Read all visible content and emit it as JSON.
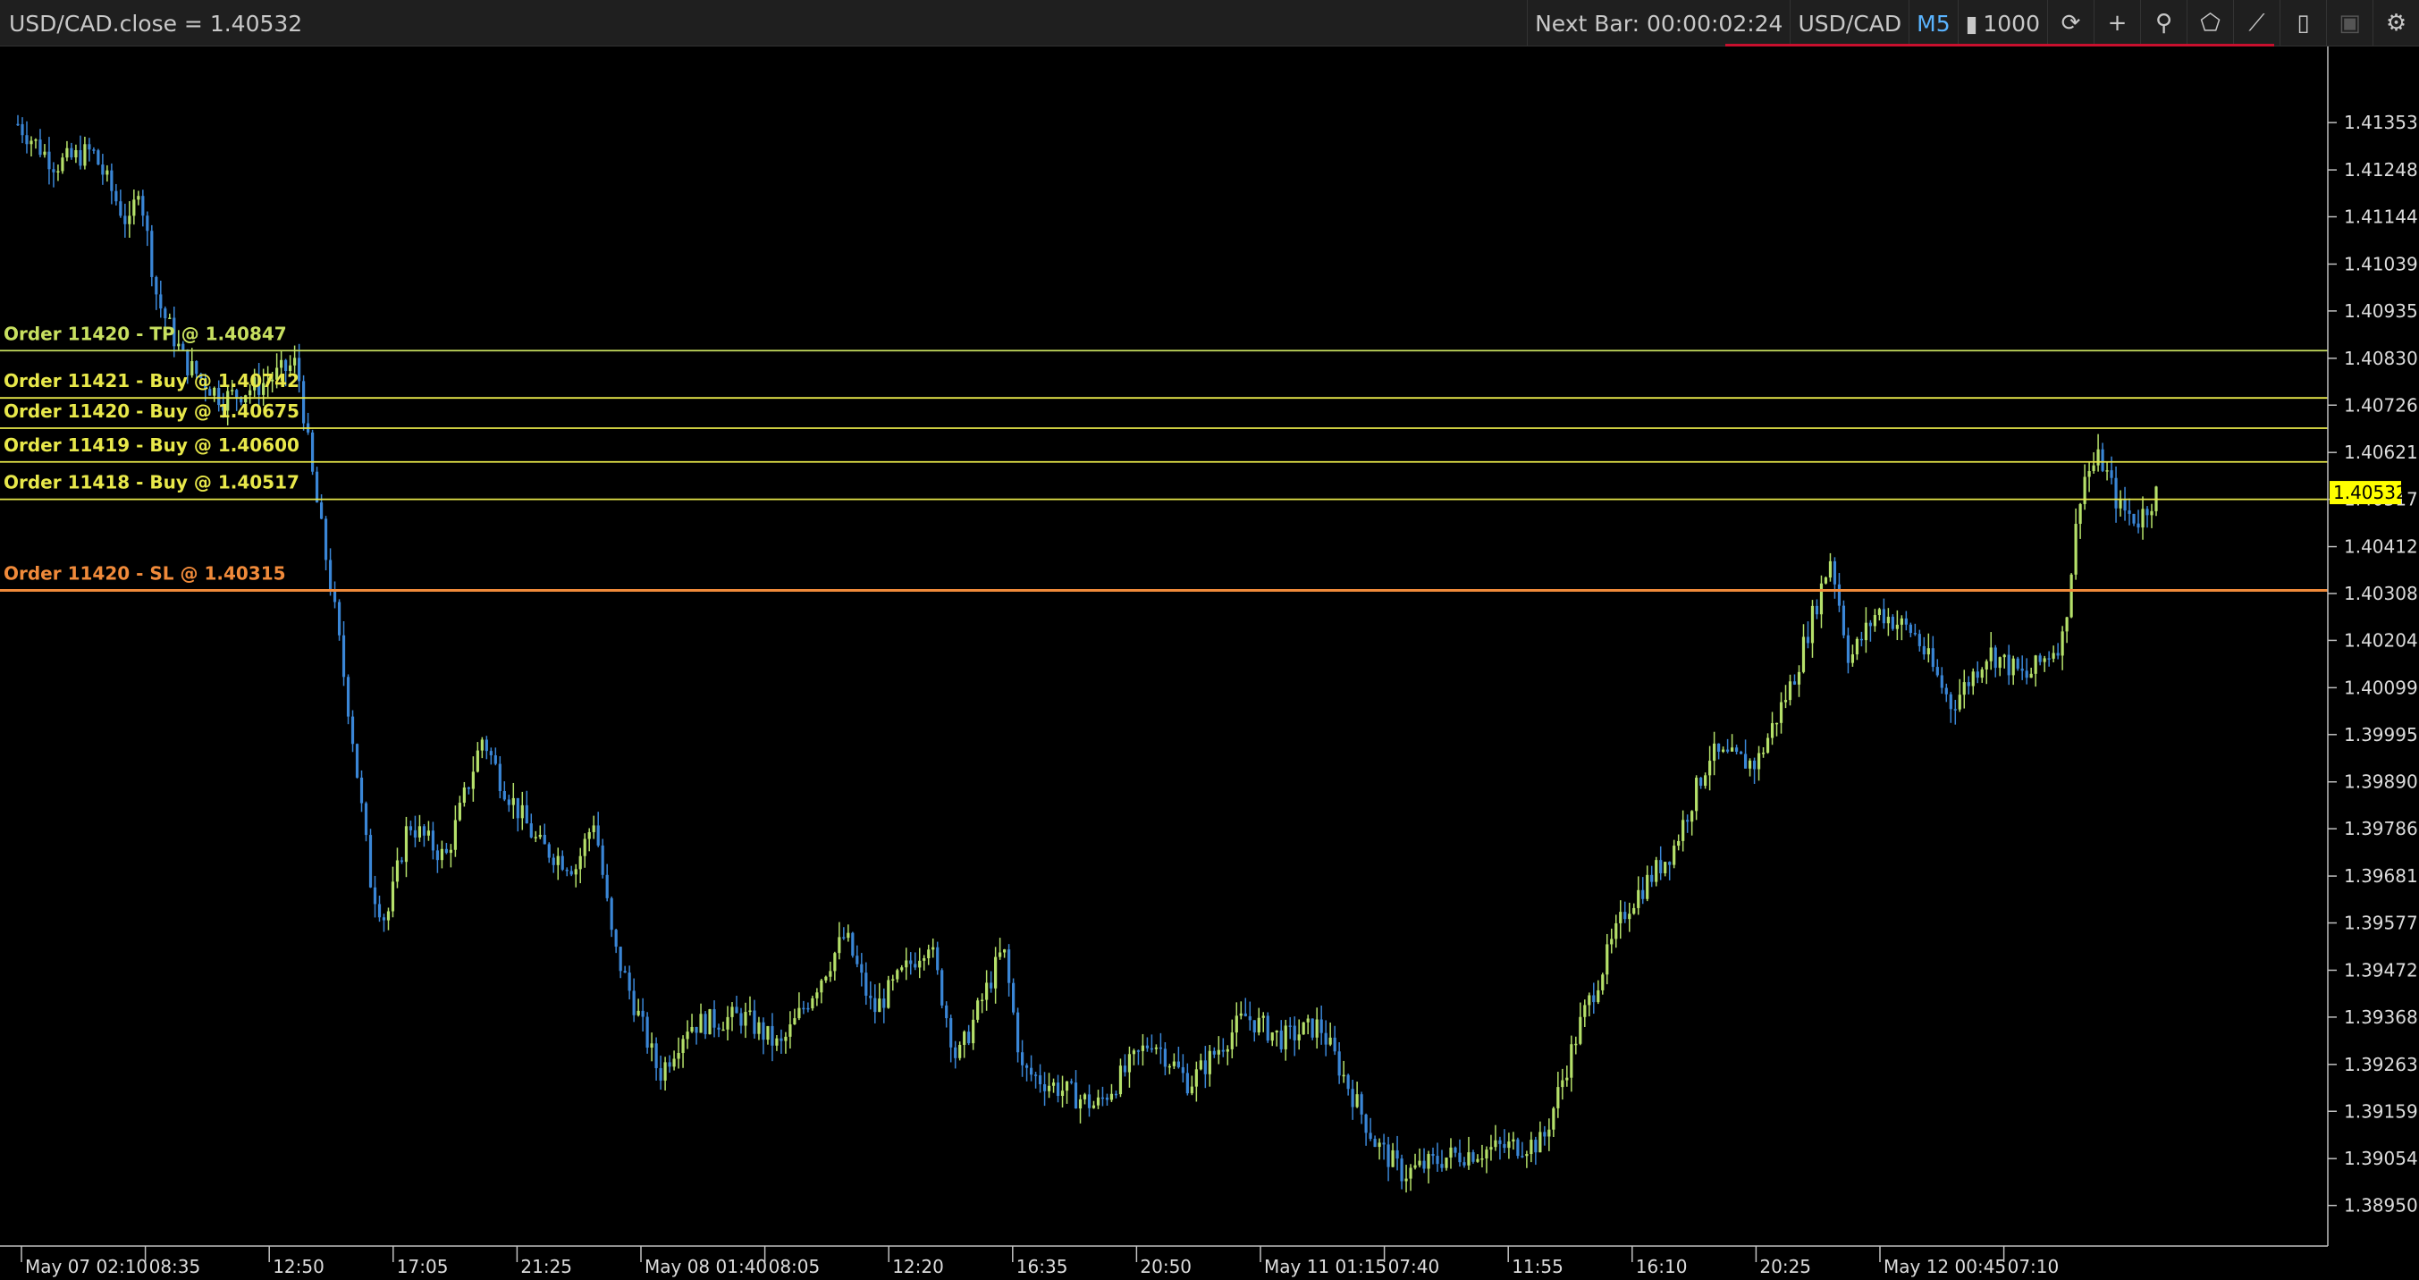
{
  "toolbar": {
    "title": "USD/CAD.close = 1.40532",
    "next_bar": "Next Bar: 00:00:02:24",
    "symbol": "USD/CAD",
    "timeframe": "M5",
    "volume": "1000",
    "icons": [
      "sync-icon",
      "crosshair-icon",
      "zoom-icon",
      "shape-icon",
      "indicator-icon",
      "template-icon",
      "screenshot-icon",
      "settings-icon"
    ]
  },
  "colors": {
    "background": "#000000",
    "bull": "#b5e06a",
    "bear": "#3a86d6",
    "order_line": "#e8e84a",
    "tp_line": "#c8e060",
    "sl_line": "#f08a3a",
    "price_tag_bg": "#ffff00"
  },
  "chart_data": {
    "type": "candlestick",
    "symbol": "USD/CAD",
    "timeframe": "M5",
    "current_price": "1.40532",
    "y_ticks": [
      "1.41353",
      "1.41248",
      "1.41144",
      "1.41039",
      "1.40935",
      "1.40830",
      "1.40726",
      "1.40621",
      "1.40517",
      "1.40412",
      "1.40308",
      "1.40204",
      "1.40099",
      "1.39995",
      "1.39890",
      "1.39786",
      "1.39681",
      "1.39577",
      "1.39472",
      "1.39368",
      "1.39263",
      "1.39159",
      "1.39054",
      "1.38950"
    ],
    "y_tick_values": [
      1.41353,
      1.41248,
      1.41144,
      1.41039,
      1.40935,
      1.4083,
      1.40726,
      1.40621,
      1.40517,
      1.40412,
      1.40308,
      1.40204,
      1.40099,
      1.39995,
      1.3989,
      1.39786,
      1.39681,
      1.39577,
      1.39472,
      1.39368,
      1.39263,
      1.39159,
      1.39054,
      1.3895
    ],
    "ylim": [
      1.3886,
      1.4151
    ],
    "x_ticks": [
      "May 07 02:10",
      "08:35",
      "12:50",
      "17:05",
      "21:25",
      "May 08 01:40",
      "08:05",
      "12:20",
      "16:35",
      "20:50",
      "May 11 01:15",
      "07:40",
      "11:55",
      "16:10",
      "20:25",
      "May 12 00:45",
      "07:10"
    ],
    "price_path": [
      [
        0,
        1.4135
      ],
      [
        0.02,
        1.4126
      ],
      [
        0.04,
        1.4129
      ],
      [
        0.06,
        1.4112
      ],
      [
        0.065,
        1.4122
      ],
      [
        0.075,
        1.4096
      ],
      [
        0.09,
        1.4082
      ],
      [
        0.11,
        1.4074
      ],
      [
        0.13,
        1.4077
      ],
      [
        0.15,
        1.4082
      ],
      [
        0.158,
        1.4058
      ],
      [
        0.17,
        1.4028
      ],
      [
        0.18,
        1.3999
      ],
      [
        0.19,
        1.3966
      ],
      [
        0.198,
        1.3958
      ],
      [
        0.21,
        1.398
      ],
      [
        0.23,
        1.3972
      ],
      [
        0.25,
        1.3999
      ],
      [
        0.26,
        1.3989
      ],
      [
        0.28,
        1.3975
      ],
      [
        0.3,
        1.397
      ],
      [
        0.31,
        1.3981
      ],
      [
        0.32,
        1.3953
      ],
      [
        0.345,
        1.3924
      ],
      [
        0.36,
        1.3935
      ],
      [
        0.39,
        1.3937
      ],
      [
        0.41,
        1.393
      ],
      [
        0.445,
        1.3955
      ],
      [
        0.46,
        1.3938
      ],
      [
        0.49,
        1.3954
      ],
      [
        0.505,
        1.3927
      ],
      [
        0.53,
        1.3952
      ],
      [
        0.54,
        1.3925
      ],
      [
        0.555,
        1.3922
      ],
      [
        0.58,
        1.3917
      ],
      [
        0.61,
        1.3932
      ],
      [
        0.63,
        1.3922
      ],
      [
        0.66,
        1.3937
      ],
      [
        0.68,
        1.3932
      ],
      [
        0.7,
        1.3935
      ],
      [
        0.73,
        1.3909
      ],
      [
        0.745,
        1.3902
      ],
      [
        0.77,
        1.3906
      ],
      [
        0.8,
        1.3908
      ],
      [
        0.82,
        1.3909
      ],
      [
        0.84,
        1.3935
      ],
      [
        0.865,
        1.3961
      ],
      [
        0.89,
        1.3974
      ],
      [
        0.91,
        1.3995
      ],
      [
        0.935,
        1.3993
      ],
      [
        0.955,
        1.4012
      ],
      [
        0.975,
        1.4039
      ],
      [
        0.985,
        1.4016
      ],
      [
        1.0,
        1.4027
      ],
      [
        1.02,
        1.4022
      ],
      [
        1.04,
        1.4006
      ],
      [
        1.06,
        1.4018
      ],
      [
        1.08,
        1.4012
      ],
      [
        1.1,
        1.4021
      ],
      [
        1.11,
        1.4056
      ],
      [
        1.12,
        1.4061
      ],
      [
        1.13,
        1.405
      ],
      [
        1.14,
        1.4047
      ],
      [
        1.15,
        1.4053
      ]
    ],
    "orders": [
      {
        "label": "Order 11420 - TP @ 1.40847",
        "kind": "tp",
        "price": 1.40847
      },
      {
        "label": "Order 11421 - Buy @ 1.40742",
        "kind": "buy",
        "price": 1.40742
      },
      {
        "label": "Order 11420 - Buy @ 1.40675",
        "kind": "buy",
        "price": 1.40675
      },
      {
        "label": "Order 11419 - Buy @ 1.40600",
        "kind": "buy",
        "price": 1.406
      },
      {
        "label": "Order 11418 - Buy @ 1.40517",
        "kind": "buy",
        "price": 1.40517
      },
      {
        "label": "Order 11420 - SL @ 1.40315",
        "kind": "sl",
        "price": 1.40315
      }
    ]
  }
}
